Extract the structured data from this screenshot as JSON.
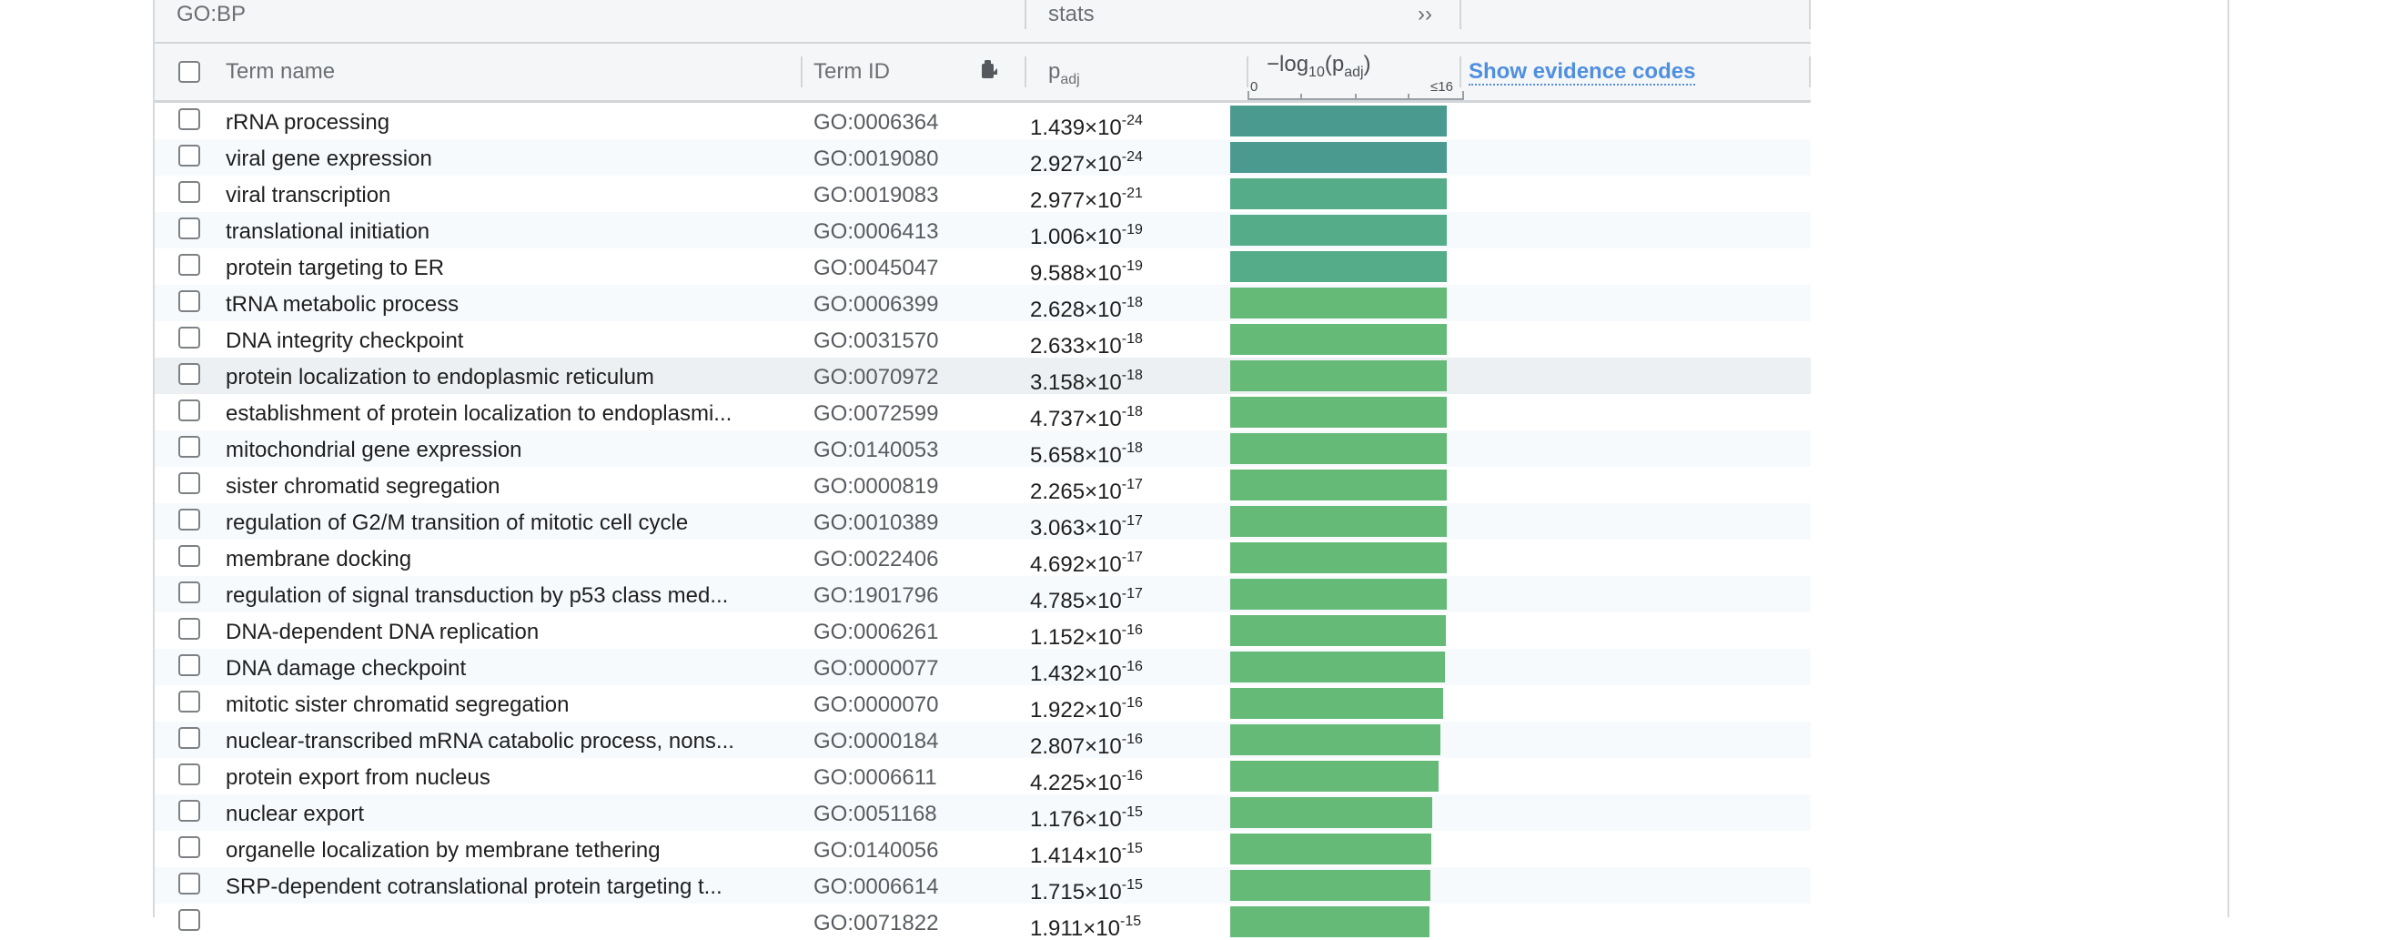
{
  "header": {
    "source_label": "GO:BP",
    "stats_label": "stats",
    "expand_icon": "double-chevron-right-icon",
    "expand_glyph": "››"
  },
  "columns": {
    "term_name": "Term name",
    "term_id": "Term ID",
    "padj_main": "p",
    "padj_sub": "adj",
    "neglog_prefix": "−log",
    "neglog_base": "10",
    "neglog_open": "(p",
    "neglog_sub": "adj",
    "neglog_close": ")",
    "scale_min": "0",
    "scale_max": "≤16",
    "evidence_link": "Show evidence codes",
    "copy_icon": "clipboard-icon"
  },
  "colors": {
    "bar_strong": "#4a9a90",
    "bar_mid": "#55ac88",
    "bar_light": "#66ba78",
    "link": "#4f8fe0"
  },
  "rows": [
    {
      "name": "rRNA processing",
      "id": "GO:0006364",
      "mant": "1.439×10",
      "exp": "-24",
      "score": 16
    },
    {
      "name": "viral gene expression",
      "id": "GO:0019080",
      "mant": "2.927×10",
      "exp": "-24",
      "score": 16
    },
    {
      "name": "viral transcription",
      "id": "GO:0019083",
      "mant": "2.977×10",
      "exp": "-21",
      "score": 16
    },
    {
      "name": "translational initiation",
      "id": "GO:0006413",
      "mant": "1.006×10",
      "exp": "-19",
      "score": 16
    },
    {
      "name": "protein targeting to ER",
      "id": "GO:0045047",
      "mant": "9.588×10",
      "exp": "-19",
      "score": 16
    },
    {
      "name": "tRNA metabolic process",
      "id": "GO:0006399",
      "mant": "2.628×10",
      "exp": "-18",
      "score": 16
    },
    {
      "name": "DNA integrity checkpoint",
      "id": "GO:0031570",
      "mant": "2.633×10",
      "exp": "-18",
      "score": 16
    },
    {
      "name": "protein localization to endoplasmic reticulum",
      "id": "GO:0070972",
      "mant": "3.158×10",
      "exp": "-18",
      "score": 16
    },
    {
      "name": "establishment of protein localization to endoplasmi...",
      "id": "GO:0072599",
      "mant": "4.737×10",
      "exp": "-18",
      "score": 16
    },
    {
      "name": "mitochondrial gene expression",
      "id": "GO:0140053",
      "mant": "5.658×10",
      "exp": "-18",
      "score": 16
    },
    {
      "name": "sister chromatid segregation",
      "id": "GO:0000819",
      "mant": "2.265×10",
      "exp": "-17",
      "score": 16
    },
    {
      "name": "regulation of G2/M transition of mitotic cell cycle",
      "id": "GO:0010389",
      "mant": "3.063×10",
      "exp": "-17",
      "score": 16
    },
    {
      "name": "membrane docking",
      "id": "GO:0022406",
      "mant": "4.692×10",
      "exp": "-17",
      "score": 16
    },
    {
      "name": "regulation of signal transduction by p53 class med...",
      "id": "GO:1901796",
      "mant": "4.785×10",
      "exp": "-17",
      "score": 16
    },
    {
      "name": "DNA-dependent DNA replication",
      "id": "GO:0006261",
      "mant": "1.152×10",
      "exp": "-16",
      "score": 15.94
    },
    {
      "name": "DNA damage checkpoint",
      "id": "GO:0000077",
      "mant": "1.432×10",
      "exp": "-16",
      "score": 15.84
    },
    {
      "name": "mitotic sister chromatid segregation",
      "id": "GO:0000070",
      "mant": "1.922×10",
      "exp": "-16",
      "score": 15.72
    },
    {
      "name": "nuclear-transcribed mRNA catabolic process, nons...",
      "id": "GO:0000184",
      "mant": "2.807×10",
      "exp": "-16",
      "score": 15.55
    },
    {
      "name": "protein export from nucleus",
      "id": "GO:0006611",
      "mant": "4.225×10",
      "exp": "-16",
      "score": 15.37
    },
    {
      "name": "nuclear export",
      "id": "GO:0051168",
      "mant": "1.176×10",
      "exp": "-15",
      "score": 14.93
    },
    {
      "name": "organelle localization by membrane tethering",
      "id": "GO:0140056",
      "mant": "1.414×10",
      "exp": "-15",
      "score": 14.85
    },
    {
      "name": "SRP-dependent cotranslational protein targeting t...",
      "id": "GO:0006614",
      "mant": "1.715×10",
      "exp": "-15",
      "score": 14.77
    },
    {
      "name": "",
      "id": "GO:0071822",
      "mant": "1.911×10",
      "exp": "-15",
      "score": 14.72
    }
  ]
}
